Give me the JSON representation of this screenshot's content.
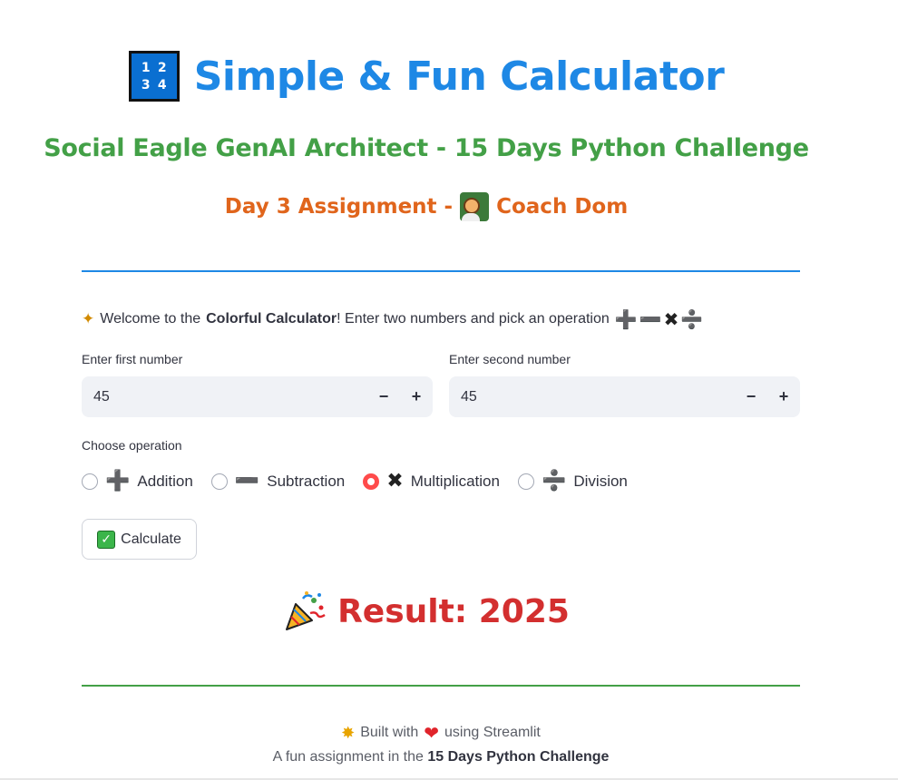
{
  "header": {
    "title_icon": "number-keypad-icon",
    "title_icon_digits": [
      "1",
      "2",
      "3",
      "4"
    ],
    "title": "Simple & Fun Calculator",
    "subtitle": "Social Eagle GenAI Architect - 15 Days Python Challenge",
    "assignment_prefix": "Day 3 Assignment -",
    "assignment_icon": "teacher-icon",
    "assignment_name": "Coach Dom"
  },
  "welcome": {
    "icon": "sparkle-icon",
    "pre": "Welcome to the",
    "bold": "Colorful Calculator",
    "post": "! Enter two numbers and pick an operation",
    "op_glyphs": "➕➖✖➗"
  },
  "inputs": {
    "first": {
      "label": "Enter first number",
      "value": "45",
      "minus": "−",
      "plus": "+"
    },
    "second": {
      "label": "Enter second number",
      "value": "45",
      "minus": "−",
      "plus": "+"
    }
  },
  "operation": {
    "label": "Choose operation",
    "options": [
      {
        "glyph": "➕",
        "label": "Addition",
        "checked": false
      },
      {
        "glyph": "➖",
        "label": "Subtraction",
        "checked": false
      },
      {
        "glyph": "✖",
        "label": "Multiplication",
        "checked": true
      },
      {
        "glyph": "➗",
        "label": "Division",
        "checked": false
      }
    ]
  },
  "calculate_button": {
    "icon": "check-mark-icon",
    "check": "✓",
    "label": "Calculate"
  },
  "result": {
    "icon": "party-popper-icon",
    "text": "Result: 2025"
  },
  "footer": {
    "star": "✸",
    "built_pre": "Built with",
    "heart": "❤",
    "built_post": "using Streamlit",
    "line2_pre": "A fun assignment in the",
    "line2_bold": "15 Days Python Challenge"
  },
  "colors": {
    "title": "#1e88e5",
    "subtitle": "#43a047",
    "assignment": "#e0651c",
    "result": "#d32f2f",
    "radio_accent": "#ff4b4b"
  }
}
